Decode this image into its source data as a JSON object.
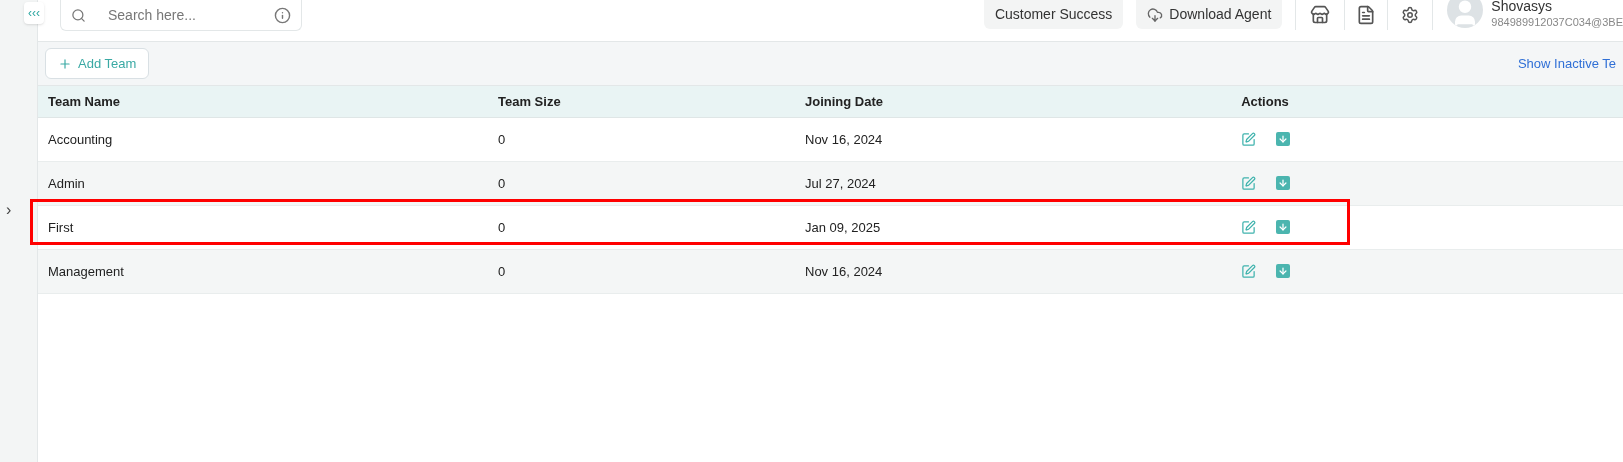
{
  "topbar": {
    "collapse_label": "‹‹‹",
    "search": {
      "placeholder": "Search here..."
    },
    "buttons": [
      "Customer Success",
      "Download Agent"
    ],
    "user": {
      "name": "Shovasys",
      "email": "984989912037C034@3BE"
    }
  },
  "sidebar": {
    "expand_label": "›"
  },
  "toolbar": {
    "add_button": "Add Team",
    "inactive_link": "Show Inactive Te"
  },
  "table": {
    "columns": [
      "Team Name",
      "Team Size",
      "Joining Date",
      "Actions"
    ],
    "rows": [
      {
        "name": "Accounting",
        "size": "0",
        "date": "Nov 16, 2024",
        "highlighted": false
      },
      {
        "name": "Admin",
        "size": "0",
        "date": "Jul 27, 2024",
        "highlighted": false
      },
      {
        "name": "First",
        "size": "0",
        "date": "Jan 09, 2025",
        "highlighted": true
      },
      {
        "name": "Management",
        "size": "0",
        "date": "Nov 16, 2024",
        "highlighted": false
      }
    ]
  }
}
